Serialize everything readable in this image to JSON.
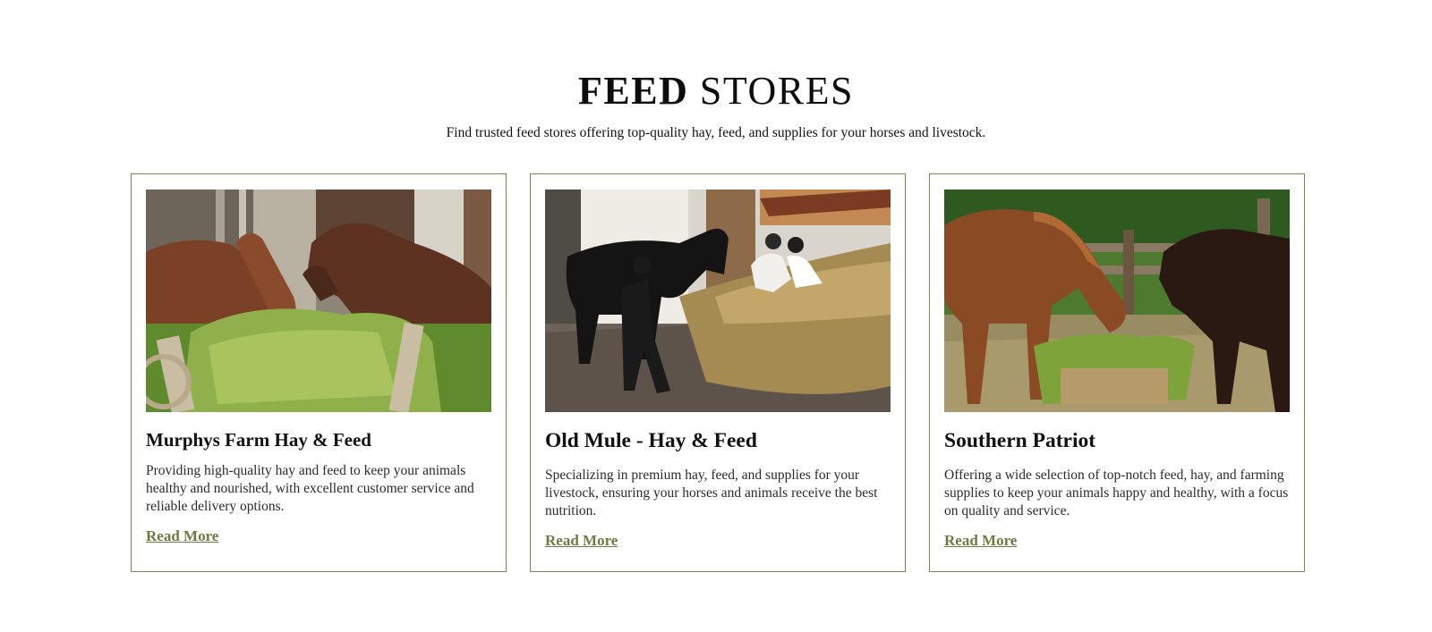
{
  "section": {
    "title_bold": "FEED",
    "title_light": "STORES",
    "subtitle": "Find trusted feed stores offering top-quality hay, feed, and supplies for your horses and livestock."
  },
  "stores": [
    {
      "name": "Murphys Farm Hay & Feed",
      "description": "Providing high-quality hay and feed to keep your animals healthy and nourished, with excellent customer service and reliable delivery options.",
      "link_label": "Read More",
      "image_icon": "horses-eating-hay-photo"
    },
    {
      "name": "Old Mule - Hay & Feed",
      "description": "Specializing in premium hay, feed, and supplies for your livestock, ensuring your horses and animals receive the best nutrition.",
      "link_label": "Read More",
      "image_icon": "riders-with-black-horse-photo"
    },
    {
      "name": "Southern Patriot",
      "description": "Offering a wide selection of top-notch feed, hay, and farming supplies to keep your animals happy and healthy, with a focus on quality and service.",
      "link_label": "Read More",
      "image_icon": "horses-grazing-paddock-photo"
    }
  ],
  "colors": {
    "accent": "#6f7a43",
    "border": "#7a8550",
    "heading": "#0d0d0d"
  }
}
